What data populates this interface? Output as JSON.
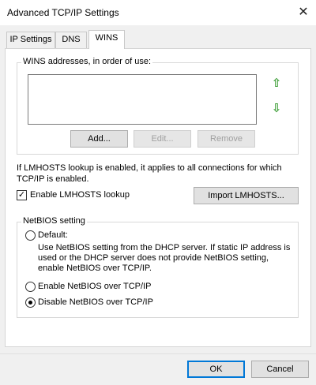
{
  "window": {
    "title": "Advanced TCP/IP Settings",
    "close_glyph": "✕"
  },
  "tabs": [
    {
      "label": "IP Settings",
      "active": false
    },
    {
      "label": "DNS",
      "active": false
    },
    {
      "label": "WINS",
      "active": true
    }
  ],
  "wins": {
    "group_label": "WINS addresses, in order of use:",
    "addresses": [],
    "move_up_glyph": "⇧",
    "move_down_glyph": "⇩",
    "add_label": "Add...",
    "edit_label": "Edit...",
    "remove_label": "Remove"
  },
  "lmhosts": {
    "info_text": "If LMHOSTS lookup is enabled, it applies to all connections for which TCP/IP is enabled.",
    "enable_label": "Enable LMHOSTS lookup",
    "enable_checked": true,
    "check_glyph": "✓",
    "import_label": "Import LMHOSTS..."
  },
  "netbios": {
    "group_label": "NetBIOS setting",
    "default_label": "Default:",
    "default_desc": "Use NetBIOS setting from the DHCP server. If static IP address is used or the DHCP server does not provide NetBIOS setting, enable NetBIOS over TCP/IP.",
    "enable_label": "Enable NetBIOS over TCP/IP",
    "disable_label": "Disable NetBIOS over TCP/IP",
    "selected": "disable"
  },
  "footer": {
    "ok_label": "OK",
    "cancel_label": "Cancel"
  }
}
